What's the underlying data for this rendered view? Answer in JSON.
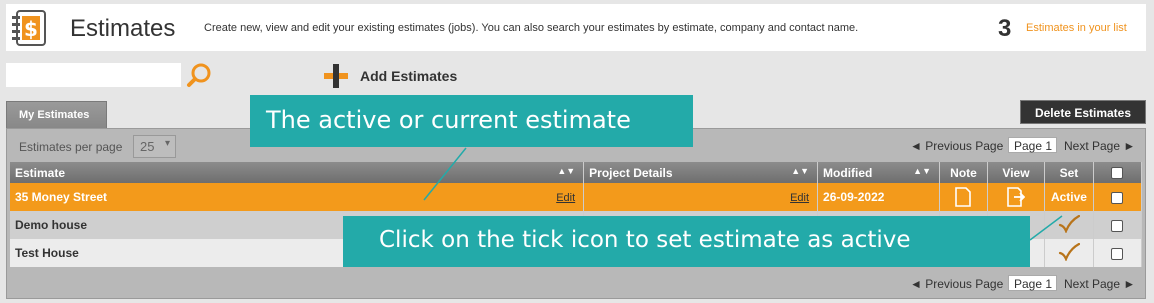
{
  "header": {
    "title": "Estimates",
    "description": "Create new, view and edit your existing estimates (jobs). You can also search your estimates by estimate, company and contact name.",
    "count": "3",
    "count_label": "Estimates in your list"
  },
  "toolbar": {
    "search_value": "",
    "add_label": "Add Estimates",
    "delete_label": "Delete Estimates"
  },
  "tabs": [
    {
      "label": "My Estimates"
    }
  ],
  "pagination": {
    "per_page_label": "Estimates per page",
    "per_page_value": "25",
    "prev_label": "◄ Previous Page",
    "page_label": "Page 1",
    "next_label": "Next Page ►"
  },
  "table": {
    "columns": [
      "Estimate",
      "Project Details",
      "Modified",
      "Note",
      "View",
      "Set"
    ],
    "rows": [
      {
        "estimate": "35 Money Street",
        "edit1": "Edit",
        "edit2": "Edit",
        "modified": "26-09-2022",
        "set": "Active"
      },
      {
        "estimate": "Demo house",
        "modified": "",
        "set": ""
      },
      {
        "estimate": "Test House",
        "modified": "",
        "set": ""
      }
    ]
  },
  "callouts": {
    "active": "The active or current estimate",
    "tick": "Click on the tick icon to set estimate as active"
  },
  "colors": {
    "accent": "#f39a1b",
    "callout": "#23aaa9",
    "header_bar": "#7a7a7a"
  }
}
